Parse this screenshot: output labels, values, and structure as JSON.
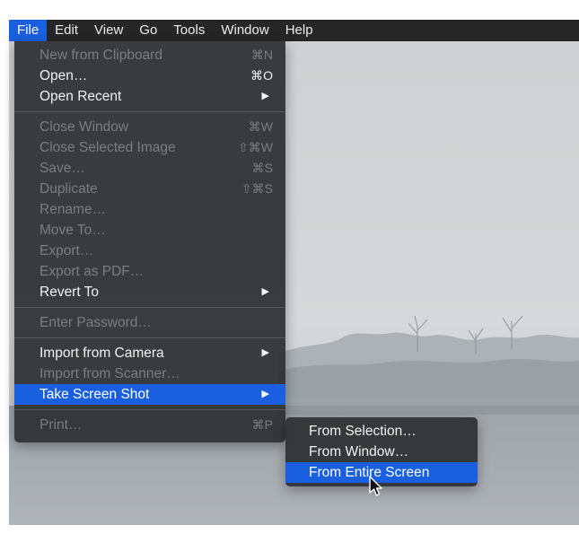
{
  "menubar": {
    "items": [
      {
        "label": "File",
        "active": true
      },
      {
        "label": "Edit"
      },
      {
        "label": "View"
      },
      {
        "label": "Go"
      },
      {
        "label": "Tools"
      },
      {
        "label": "Window"
      },
      {
        "label": "Help"
      }
    ]
  },
  "file_menu": {
    "new_from_clipboard": {
      "label": "New from Clipboard",
      "shortcut": "⌘N"
    },
    "open": {
      "label": "Open…",
      "shortcut": "⌘O"
    },
    "open_recent": {
      "label": "Open Recent"
    },
    "close_window": {
      "label": "Close Window",
      "shortcut": "⌘W"
    },
    "close_selected_image": {
      "label": "Close Selected Image",
      "shortcut": "⇧⌘W"
    },
    "save": {
      "label": "Save…",
      "shortcut": "⌘S"
    },
    "duplicate": {
      "label": "Duplicate",
      "shortcut": "⇧⌘S"
    },
    "rename": {
      "label": "Rename…"
    },
    "move_to": {
      "label": "Move To…"
    },
    "export": {
      "label": "Export…"
    },
    "export_pdf": {
      "label": "Export as PDF…"
    },
    "revert_to": {
      "label": "Revert To"
    },
    "enter_password": {
      "label": "Enter Password…"
    },
    "import_camera": {
      "label": "Import from Camera"
    },
    "import_scanner": {
      "label": "Import from Scanner…"
    },
    "take_screenshot": {
      "label": "Take Screen Shot"
    },
    "print": {
      "label": "Print…",
      "shortcut": "⌘P"
    }
  },
  "submenu": {
    "from_selection": {
      "label": "From Selection…"
    },
    "from_window": {
      "label": "From Window…"
    },
    "from_entire_screen": {
      "label": "From Entire Screen"
    }
  },
  "icons": {
    "submenu_arrow": "▶",
    "cursor": "arrow-cursor-icon"
  },
  "colors": {
    "highlight": "#1a5fe0",
    "menubar": "#262626",
    "menu_bg": "#2e2f31",
    "disabled_text": "#7b7d80"
  }
}
